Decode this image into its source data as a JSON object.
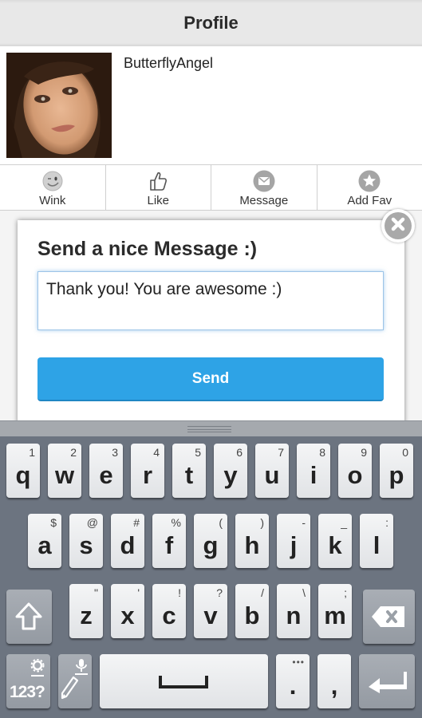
{
  "header": {
    "title": "Profile"
  },
  "profile": {
    "username": "ButterflyAngel"
  },
  "actions": [
    {
      "label": "Wink",
      "icon": "wink-icon"
    },
    {
      "label": "Like",
      "icon": "thumbs-up-icon"
    },
    {
      "label": "Message",
      "icon": "envelope-icon"
    },
    {
      "label": "Add Fav",
      "icon": "star-icon"
    }
  ],
  "dialog": {
    "title": "Send a nice Message :)",
    "message_value": "Thank you! You are awesome :)",
    "send_label": "Send"
  },
  "colors": {
    "accent": "#2ea3e6",
    "keyboard_bg": "#6c7480"
  },
  "keyboard": {
    "row1": [
      {
        "k": "q",
        "h": "1"
      },
      {
        "k": "w",
        "h": "2"
      },
      {
        "k": "e",
        "h": "3"
      },
      {
        "k": "r",
        "h": "4"
      },
      {
        "k": "t",
        "h": "5"
      },
      {
        "k": "y",
        "h": "6"
      },
      {
        "k": "u",
        "h": "7"
      },
      {
        "k": "i",
        "h": "8"
      },
      {
        "k": "o",
        "h": "9"
      },
      {
        "k": "p",
        "h": "0"
      }
    ],
    "row2": [
      {
        "k": "a",
        "h": "$"
      },
      {
        "k": "s",
        "h": "@"
      },
      {
        "k": "d",
        "h": "#"
      },
      {
        "k": "f",
        "h": "%"
      },
      {
        "k": "g",
        "h": "("
      },
      {
        "k": "h",
        "h": ")"
      },
      {
        "k": "j",
        "h": "-"
      },
      {
        "k": "k",
        "h": "_"
      },
      {
        "k": "l",
        "h": ":"
      }
    ],
    "row3": [
      {
        "k": "z",
        "h": "\""
      },
      {
        "k": "x",
        "h": "'"
      },
      {
        "k": "c",
        "h": "!"
      },
      {
        "k": "v",
        "h": "?"
      },
      {
        "k": "b",
        "h": "/"
      },
      {
        "k": "n",
        "h": "\\"
      },
      {
        "k": "m",
        "h": ";"
      }
    ],
    "symbols_label": "123?",
    "period": ".",
    "comma": ","
  }
}
